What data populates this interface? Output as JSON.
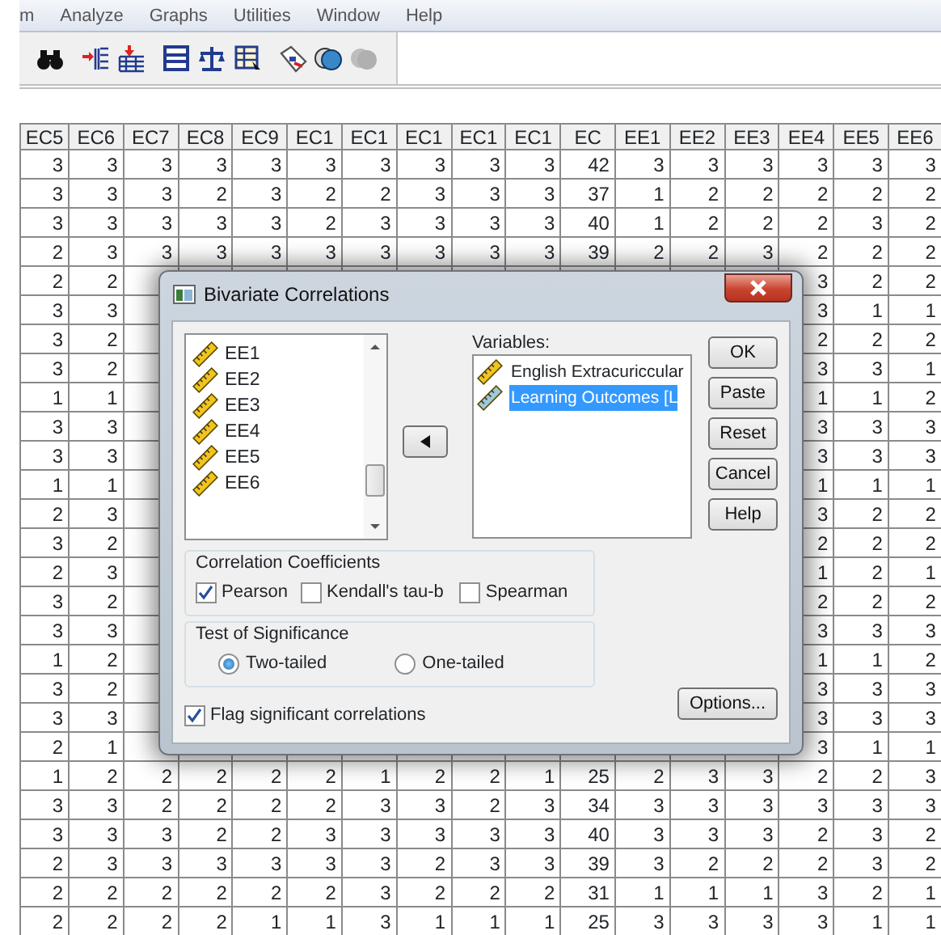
{
  "menu_bar": [
    "m",
    "Analyze",
    "Graphs",
    "Utilities",
    "Window",
    "Help"
  ],
  "table": {
    "columns": [
      "EC5",
      "EC6",
      "EC7",
      "EC8",
      "EC9",
      "EC1",
      "EC1",
      "EC1",
      "EC1",
      "EC1",
      "EC",
      "EE1",
      "EE2",
      "EE3",
      "EE4",
      "EE5",
      "EE6"
    ],
    "rows": [
      {
        "kind": "full",
        "cells": [
          "3",
          "3",
          "3",
          "3",
          "3",
          "3",
          "3",
          "3",
          "3",
          "3",
          "42",
          "3",
          "3",
          "3",
          "3",
          "3",
          "3"
        ]
      },
      {
        "kind": "full",
        "cells": [
          "3",
          "3",
          "3",
          "2",
          "3",
          "2",
          "2",
          "3",
          "3",
          "3",
          "37",
          "1",
          "2",
          "2",
          "2",
          "2",
          "2"
        ]
      },
      {
        "kind": "full",
        "cells": [
          "3",
          "3",
          "3",
          "3",
          "3",
          "2",
          "3",
          "3",
          "3",
          "3",
          "40",
          "1",
          "2",
          "2",
          "2",
          "3",
          "2"
        ]
      },
      {
        "kind": "full",
        "cells": [
          "2",
          "3",
          "3",
          "3",
          "3",
          "3",
          "3",
          "3",
          "3",
          "3",
          "39",
          "2",
          "2",
          "3",
          "2",
          "2",
          "2"
        ]
      },
      {
        "kind": "covered",
        "left_cells": [
          "2",
          "2"
        ],
        "right_cells": [
          "3",
          "2",
          "2"
        ]
      },
      {
        "kind": "covered",
        "left_cells": [
          "3",
          "3"
        ],
        "right_cells": [
          "3",
          "1",
          "1"
        ]
      },
      {
        "kind": "covered",
        "left_cells": [
          "3",
          "2"
        ],
        "right_cells": [
          "2",
          "2",
          "2"
        ]
      },
      {
        "kind": "covered",
        "left_cells": [
          "3",
          "2"
        ],
        "right_cells": [
          "3",
          "3",
          "1"
        ]
      },
      {
        "kind": "covered",
        "left_cells": [
          "1",
          "1"
        ],
        "right_cells": [
          "1",
          "1",
          "2"
        ]
      },
      {
        "kind": "covered",
        "left_cells": [
          "3",
          "3"
        ],
        "right_cells": [
          "3",
          "3",
          "3"
        ]
      },
      {
        "kind": "covered",
        "left_cells": [
          "3",
          "3"
        ],
        "right_cells": [
          "3",
          "3",
          "3"
        ]
      },
      {
        "kind": "covered",
        "left_cells": [
          "1",
          "1"
        ],
        "right_cells": [
          "1",
          "1",
          "1"
        ]
      },
      {
        "kind": "covered",
        "left_cells": [
          "2",
          "3"
        ],
        "right_cells": [
          "3",
          "2",
          "2"
        ]
      },
      {
        "kind": "covered",
        "left_cells": [
          "3",
          "2"
        ],
        "right_cells": [
          "2",
          "2",
          "2"
        ]
      },
      {
        "kind": "covered",
        "left_cells": [
          "2",
          "3"
        ],
        "right_cells": [
          "1",
          "2",
          "1"
        ]
      },
      {
        "kind": "covered",
        "left_cells": [
          "3",
          "2"
        ],
        "right_cells": [
          "2",
          "2",
          "2"
        ]
      },
      {
        "kind": "covered",
        "left_cells": [
          "3",
          "3"
        ],
        "right_cells": [
          "3",
          "3",
          "3"
        ]
      },
      {
        "kind": "covered",
        "left_cells": [
          "1",
          "2"
        ],
        "right_cells": [
          "1",
          "1",
          "2"
        ]
      },
      {
        "kind": "covered",
        "left_cells": [
          "3",
          "2"
        ],
        "right_cells": [
          "3",
          "3",
          "3"
        ]
      },
      {
        "kind": "covered",
        "left_cells": [
          "3",
          "3"
        ],
        "right_cells": [
          "3",
          "3",
          "3"
        ]
      },
      {
        "kind": "covered",
        "left_cells": [
          "2",
          "1"
        ],
        "right_cells": [
          "3",
          "1",
          "1"
        ]
      },
      {
        "kind": "full",
        "cells": [
          "1",
          "2",
          "2",
          "2",
          "2",
          "2",
          "1",
          "2",
          "2",
          "1",
          "25",
          "2",
          "3",
          "3",
          "2",
          "2",
          "3"
        ]
      },
      {
        "kind": "full",
        "cells": [
          "3",
          "3",
          "2",
          "2",
          "2",
          "2",
          "3",
          "3",
          "2",
          "3",
          "34",
          "3",
          "3",
          "3",
          "3",
          "3",
          "3"
        ]
      },
      {
        "kind": "full",
        "cells": [
          "3",
          "3",
          "3",
          "2",
          "2",
          "3",
          "3",
          "3",
          "3",
          "3",
          "40",
          "3",
          "3",
          "3",
          "2",
          "3",
          "2"
        ]
      },
      {
        "kind": "full",
        "cells": [
          "2",
          "3",
          "3",
          "3",
          "3",
          "3",
          "3",
          "2",
          "3",
          "3",
          "39",
          "3",
          "2",
          "2",
          "2",
          "3",
          "2"
        ]
      },
      {
        "kind": "full",
        "cells": [
          "2",
          "2",
          "2",
          "2",
          "2",
          "2",
          "3",
          "2",
          "2",
          "2",
          "31",
          "1",
          "1",
          "1",
          "3",
          "2",
          "1"
        ]
      },
      {
        "kind": "full",
        "cells": [
          "2",
          "2",
          "2",
          "2",
          "1",
          "1",
          "3",
          "1",
          "1",
          "1",
          "25",
          "3",
          "3",
          "3",
          "3",
          "1",
          "1"
        ]
      }
    ]
  },
  "dialog": {
    "title": "Bivariate Correlations",
    "source_list": [
      "EE1",
      "EE2",
      "EE3",
      "EE4",
      "EE5",
      "EE6"
    ],
    "variables_label": "Variables:",
    "variables": [
      {
        "label": "English Extracuriccular",
        "selected": false
      },
      {
        "label": "Learning Outcomes [L",
        "selected": true
      }
    ],
    "buttons": [
      "OK",
      "Paste",
      "Reset",
      "Cancel",
      "Help"
    ],
    "correlation_coefficients": {
      "title": "Correlation Coefficients",
      "options": [
        {
          "label": "Pearson",
          "checked": true
        },
        {
          "label": "Kendall's tau-b",
          "checked": false
        },
        {
          "label": "Spearman",
          "checked": false
        }
      ]
    },
    "test_of_significance": {
      "title": "Test of Significance",
      "options": [
        {
          "label": "Two-tailed",
          "selected": true
        },
        {
          "label": "One-tailed",
          "selected": false
        }
      ]
    },
    "flag_significant": {
      "label": "Flag significant correlations",
      "checked": true
    },
    "options_button": "Options..."
  }
}
